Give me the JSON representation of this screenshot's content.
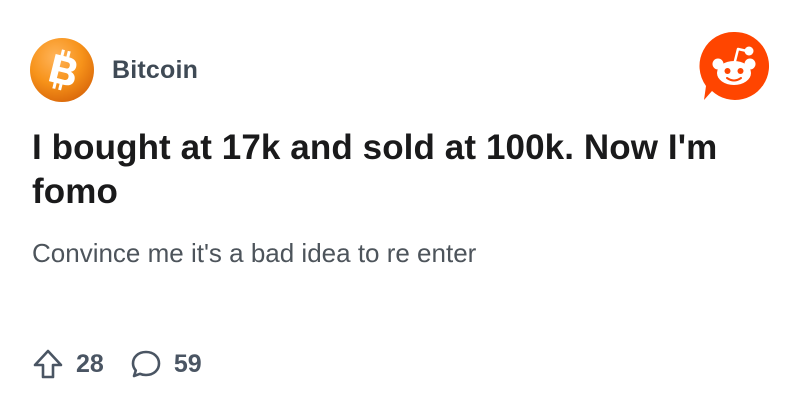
{
  "post": {
    "subreddit": "Bitcoin",
    "title": "I bought at 17k and sold at 100k. Now I'm fomo",
    "body": "Convince me it's a bad idea to re enter",
    "upvotes": "28",
    "comments": "59"
  },
  "icons": {
    "subreddit_avatar": "bitcoin-icon",
    "brand_logo": "reddit-logo-icon",
    "upvote": "upvote-arrow-icon",
    "comment": "comment-bubble-icon"
  },
  "colors": {
    "bitcoin_orange": "#f7931a",
    "reddit_orange": "#ff4500",
    "title_text": "#1a1a1b",
    "body_text": "#4d545b",
    "meta_text": "#4a5563"
  }
}
